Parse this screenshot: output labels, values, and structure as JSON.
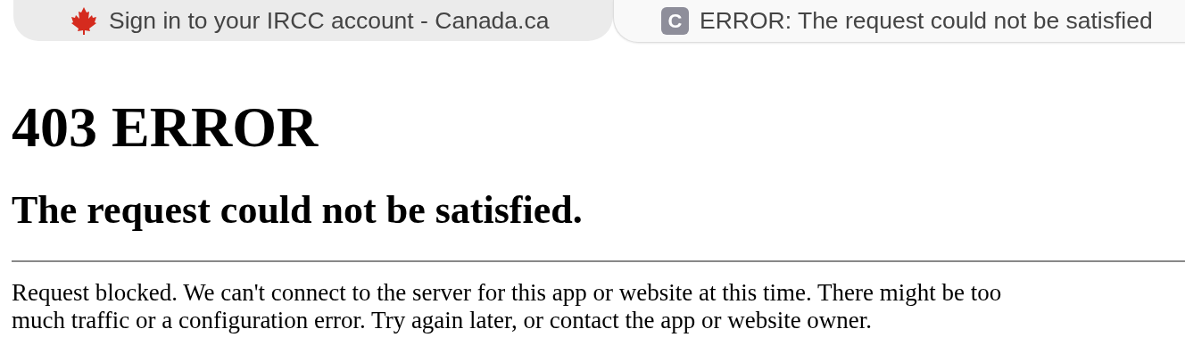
{
  "tabs": [
    {
      "title": "Sign in to your IRCC account - Canada.ca",
      "kind": "leaf",
      "selected": false
    },
    {
      "title": "ERROR: The request could not be satisfied",
      "kind": "letter",
      "letter": "C",
      "selected": true
    }
  ],
  "page": {
    "heading": "403 ERROR",
    "subheading": "The request could not be satisfied.",
    "message_lines": [
      "Request blocked. We can't connect to the server for this app or website at this time. There might be too",
      "much traffic or a configuration error. Try again later, or contact the app or website owner."
    ]
  }
}
